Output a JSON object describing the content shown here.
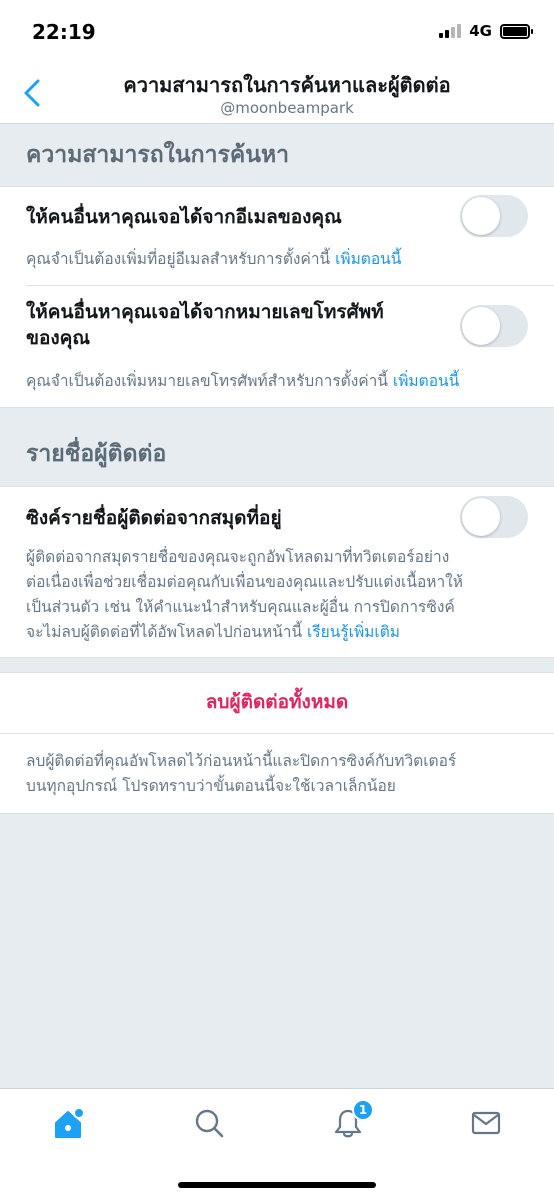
{
  "status": {
    "time": "22:19",
    "network": "4G"
  },
  "header": {
    "title": "ความสามารถในการค้นหาและผู้ติดต่อ",
    "subtitle": "@moonbeampark"
  },
  "discoverability": {
    "title": "ความสามารถในการค้นหา",
    "email": {
      "label": "ให้คนอื่นหาคุณเจอได้จากอีเมลของคุณ",
      "desc": "คุณจำเป็นต้องเพิ่มที่อยู่อีเมลสำหรับการตั้งค่านี้",
      "link": "เพิ่มตอนนี้",
      "enabled": false
    },
    "phone": {
      "label_line1": "ให้คนอื่นหาคุณเจอได้จากหมายเลขโทรศัพท์",
      "label_line2": "ของคุณ",
      "desc": "คุณจำเป็นต้องเพิ่มหมายเลขโทรศัพท์สำหรับการตั้งค่านี้",
      "link": "เพิ่มตอนนี้",
      "enabled": false
    }
  },
  "contacts": {
    "title": "รายชื่อผู้ติดต่อ",
    "sync": {
      "label": "ซิงค์รายชื่อผู้ติดต่อจากสมุดที่อยู่",
      "desc_line1": "ผู้ติดต่อจากสมุดรายชื่อของคุณจะถูกอัพโหลดมาที่ทวิตเตอร์อย่าง",
      "desc_line2": "ต่อเนื่องเพื่อช่วยเชื่อมต่อคุณกับเพื่อนของคุณและปรับแต่งเนื้อหาให้",
      "desc_line3": "เป็นส่วนตัว เช่น ให้คำแนะนำสำหรับคุณและผู้อื่น การปิดการซิงค์",
      "desc_line4": "จะไม่ลบผู้ติดต่อที่ได้อัพโหลดไปก่อนหน้านี้",
      "link": "เรียนรู้เพิ่มเติม",
      "enabled": false
    }
  },
  "remove": {
    "button": "ลบผู้ติดต่อทั้งหมด",
    "desc_line1": "ลบผู้ติดต่อที่คุณอัพโหลดไว้ก่อนหน้านี้และปิดการซิงค์กับทวิตเตอร์",
    "desc_line2": "บนทุกอุปกรณ์ โปรดทราบว่าขั้นตอนนี้จะใช้เวลาเล็กน้อย"
  },
  "tabbar": {
    "notifications_badge": "1",
    "icons": [
      "home-icon",
      "search-icon",
      "bell-icon",
      "mail-icon"
    ]
  },
  "colors": {
    "accent": "#1da1f2",
    "link": "#1b95e0",
    "danger": "#e0245e",
    "background": "#e6ecf0"
  }
}
